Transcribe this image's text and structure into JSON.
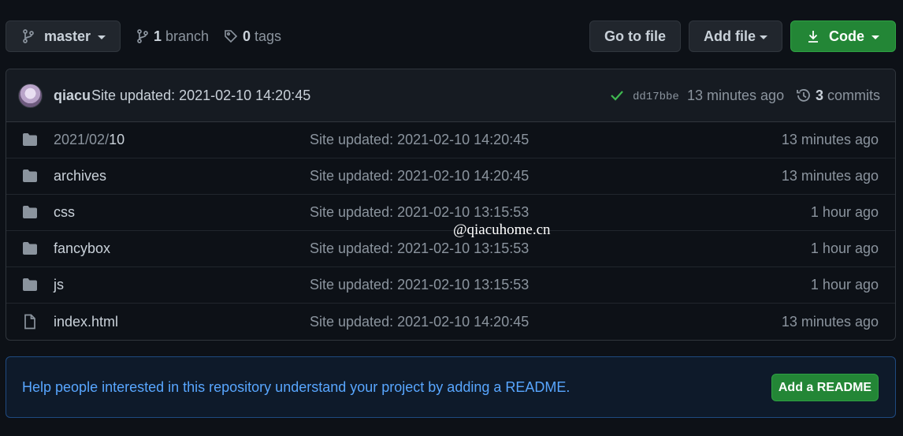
{
  "toolbar": {
    "branch_name": "master",
    "branches_count": "1",
    "branches_label": "branch",
    "tags_count": "0",
    "tags_label": "tags",
    "goto_file_label": "Go to file",
    "add_file_label": "Add file",
    "code_label": "Code"
  },
  "commit": {
    "author": "qiacu",
    "message": "Site updated: 2021-02-10 14:20:45",
    "sha": "dd17bbe",
    "age": "13 minutes ago",
    "commits_count": "3",
    "commits_label": "commits"
  },
  "files": [
    {
      "type": "folder",
      "name_prefix": "2021/02/",
      "name": "10",
      "message": "Site updated: 2021-02-10 14:20:45",
      "age": "13 minutes ago"
    },
    {
      "type": "folder",
      "name_prefix": "",
      "name": "archives",
      "message": "Site updated: 2021-02-10 14:20:45",
      "age": "13 minutes ago"
    },
    {
      "type": "folder",
      "name_prefix": "",
      "name": "css",
      "message": "Site updated: 2021-02-10 13:15:53",
      "age": "1 hour ago"
    },
    {
      "type": "folder",
      "name_prefix": "",
      "name": "fancybox",
      "message": "Site updated: 2021-02-10 13:15:53",
      "age": "1 hour ago"
    },
    {
      "type": "folder",
      "name_prefix": "",
      "name": "js",
      "message": "Site updated: 2021-02-10 13:15:53",
      "age": "1 hour ago"
    },
    {
      "type": "file",
      "name_prefix": "",
      "name": "index.html",
      "message": "Site updated: 2021-02-10 14:20:45",
      "age": "13 minutes ago"
    }
  ],
  "watermark": "@qiacuhome.cn",
  "readme": {
    "text": "Help people interested in this repository understand your project by adding a README.",
    "button_label": "Add a README"
  },
  "colors": {
    "background": "#0d1117",
    "primary_green": "#238636",
    "link_blue": "#58a6ff",
    "muted": "#8b949e"
  }
}
